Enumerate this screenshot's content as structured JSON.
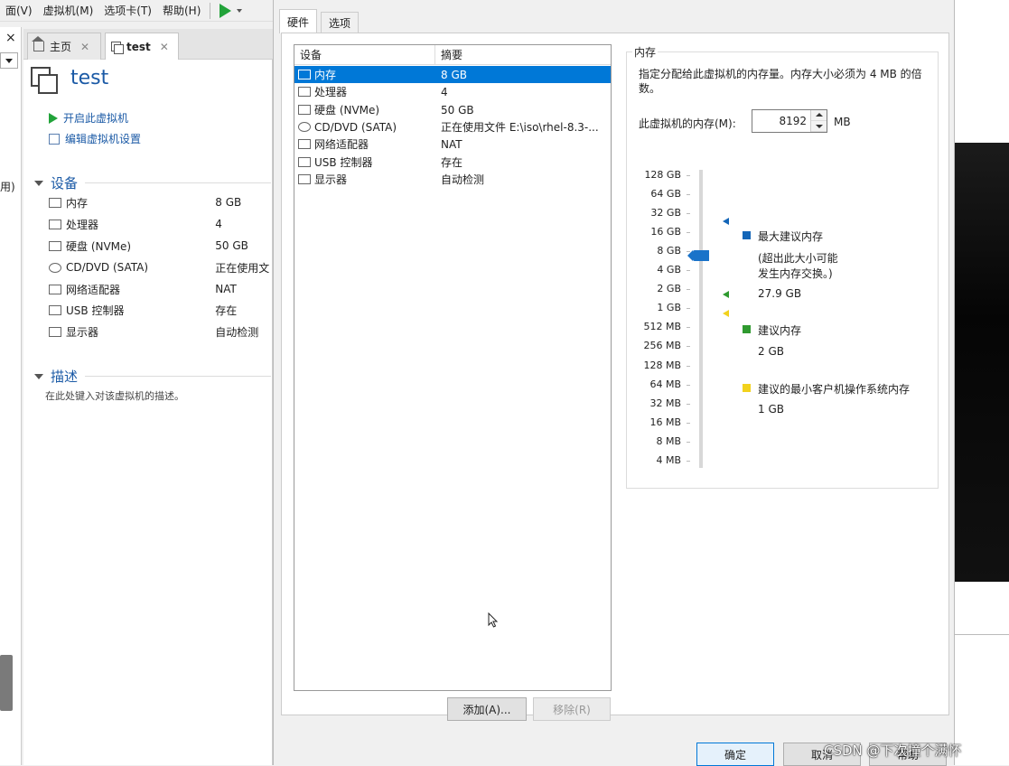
{
  "menubar": {
    "items": [
      "面(V)",
      "虚拟机(M)",
      "选项卡(T)",
      "帮助(H)"
    ]
  },
  "left_strip": {
    "close": "×",
    "text": "用)"
  },
  "tabs": [
    {
      "label": "主页",
      "icon": "home-icon"
    },
    {
      "label": "test",
      "icon": "vm-icon"
    }
  ],
  "vm": {
    "title": "test",
    "actions": [
      "开启此虚拟机",
      "编辑虚拟机设置"
    ],
    "devices_heading": "设备",
    "devices": [
      {
        "name": "内存",
        "value": "8 GB",
        "icon": "memory-icon"
      },
      {
        "name": "处理器",
        "value": "4",
        "icon": "cpu-icon"
      },
      {
        "name": "硬盘 (NVMe)",
        "value": "50 GB",
        "icon": "disk-icon"
      },
      {
        "name": "CD/DVD (SATA)",
        "value": "正在使用文",
        "icon": "cd-icon"
      },
      {
        "name": "网络适配器",
        "value": "NAT",
        "icon": "network-icon"
      },
      {
        "name": "USB 控制器",
        "value": "存在",
        "icon": "usb-icon"
      },
      {
        "name": "显示器",
        "value": "自动检测",
        "icon": "monitor-icon"
      }
    ],
    "desc_heading": "描述",
    "desc_placeholder": "在此处键入对该虚拟机的描述。"
  },
  "dialog": {
    "tabs": [
      "硬件",
      "选项"
    ],
    "list_headers": [
      "设备",
      "摘要"
    ],
    "rows": [
      {
        "device": "内存",
        "summary": "8 GB",
        "selected": true
      },
      {
        "device": "处理器",
        "summary": "4",
        "selected": false
      },
      {
        "device": "硬盘 (NVMe)",
        "summary": "50 GB",
        "selected": false
      },
      {
        "device": "CD/DVD (SATA)",
        "summary": "正在使用文件 E:\\iso\\rhel-8.3-...",
        "selected": false
      },
      {
        "device": "网络适配器",
        "summary": "NAT",
        "selected": false
      },
      {
        "device": "USB 控制器",
        "summary": "存在",
        "selected": false
      },
      {
        "device": "显示器",
        "summary": "自动检测",
        "selected": false
      }
    ],
    "add_button": "添加(A)...",
    "remove_button": "移除(R)",
    "ok_button": "确定",
    "cancel_button": "取消",
    "help_button": "帮助"
  },
  "memory": {
    "group_title": "内存",
    "description": "指定分配给此虚拟机的内存量。内存大小必须为 4 MB 的倍数。",
    "field_label": "此虚拟机的内存(M):",
    "value": "8192",
    "unit": "MB",
    "scale_labels": [
      "128 GB",
      "64 GB",
      "32 GB",
      "16 GB",
      "8 GB",
      "4 GB",
      "2 GB",
      "1 GB",
      "512 MB",
      "256 MB",
      "128 MB",
      "64 MB",
      "32 MB",
      "16 MB",
      "8 MB",
      "4 MB"
    ],
    "slider_position": "8 GB",
    "legend": {
      "max_label": "最大建议内存",
      "max_note_line1": "(超出此大小可能",
      "max_note_line2": "发生内存交换。)",
      "max_value": "27.9 GB",
      "rec_label": "建议内存",
      "rec_value": "2 GB",
      "min_label": "建议的最小客户机操作系统内存",
      "min_value": "1 GB"
    },
    "colors": {
      "max": "#1466b8",
      "recommended": "#2f9a2f",
      "minimum": "#f2d21d",
      "selection": "#0078d7"
    }
  },
  "watermark": "CSDN @下次撞个满怀"
}
